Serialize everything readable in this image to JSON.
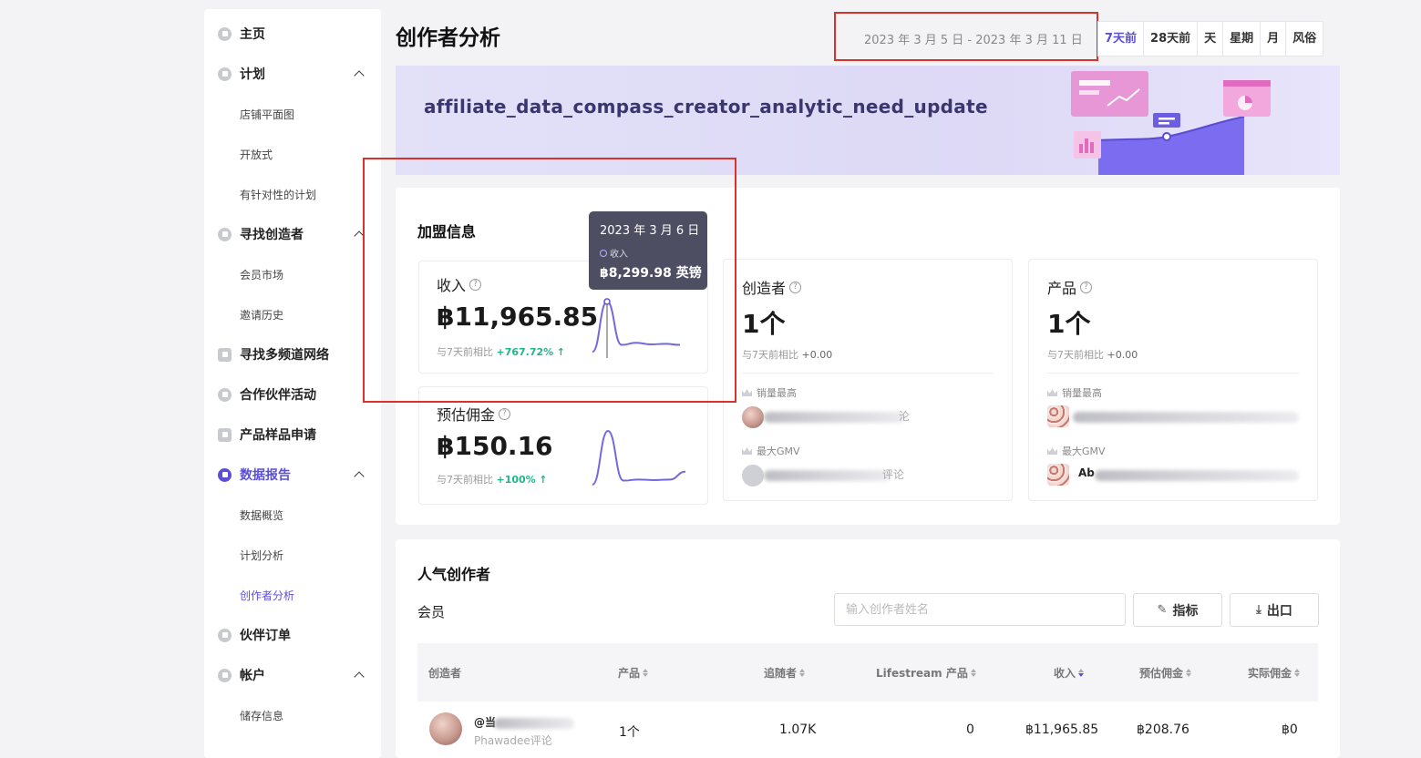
{
  "sidebar": {
    "home": "主页",
    "plan": "计划",
    "plan_items": [
      "店铺平面图",
      "开放式",
      "有针对性的计划"
    ],
    "find_creators": "寻找创造者",
    "find_creators_items": [
      "会员市场",
      "邀请历史"
    ],
    "find_mcn": "寻找多频道网络",
    "partner_campaigns": "合作伙伴活动",
    "sample_requests": "产品样品申请",
    "data_reports": "数据报告",
    "data_reports_items": [
      "数据概览",
      "计划分析",
      "创作者分析"
    ],
    "partner_orders": "伙伴订单",
    "account": "帐户",
    "account_items": [
      "储存信息"
    ]
  },
  "header": {
    "title": "创作者分析",
    "date_range": "2023 年 3 月 5 日 - 2023 年 3 月 11 日",
    "periods": [
      "7天前",
      "28天前",
      "天",
      "星期",
      "月",
      "风俗"
    ],
    "active_period": "7天前"
  },
  "banner": {
    "text": "affiliate_data_compass_creator_analytic_need_update"
  },
  "affiliate_info": {
    "title": "加盟信息",
    "revenue": {
      "label": "收入",
      "value": "฿11,965.85",
      "compare_label": "与7天前相比",
      "compare_value": "+767.72%",
      "sparkline": [
        0.05,
        1.0,
        0.18,
        0.22,
        0.19,
        0.2,
        0.18
      ]
    },
    "est_commission": {
      "label": "预估佣金",
      "value": "฿150.16",
      "compare_label": "与7天前相比",
      "compare_value": "+100%",
      "sparkline": [
        0.05,
        1.0,
        0.12,
        0.14,
        0.13,
        0.14,
        0.28
      ]
    },
    "creators": {
      "label": "创造者",
      "value": "1个",
      "compare_label": "与7天前相比",
      "compare_value": "+0.00",
      "top_sales_label": "销量最高",
      "top_gmv_label": "最大GMV",
      "top_sales_tail": "沦",
      "top_gmv_tail": "评论"
    },
    "products": {
      "label": "产品",
      "value": "1个",
      "compare_label": "与7天前相比",
      "compare_value": "+0.00",
      "top_sales_label": "销量最高",
      "top_gmv_label": "最大GMV",
      "top_gmv_prefix": "Ab"
    },
    "tooltip": {
      "date": "2023 年 3 月 6 日",
      "series": "收入",
      "value": "฿8,299.98 英镑"
    }
  },
  "popular_creators": {
    "title": "人气创作者",
    "member_label": "会员",
    "search_placeholder": "输入创作者姓名",
    "metrics_button": "指标",
    "export_button": "出口",
    "columns": [
      "创造者",
      "产品",
      "追随者",
      "Lifestream 产品",
      "收入",
      "预估佣金",
      "实际佣金"
    ],
    "rows": [
      {
        "handle": "@当",
        "subtitle": "Phawadee评论",
        "products": "1个",
        "followers": "1.07K",
        "live_products": "0",
        "revenue": "฿11,965.85",
        "est_commission": "฿208.76",
        "actual_commission": "฿0"
      }
    ]
  },
  "colors": {
    "accent": "#5b4fd6",
    "up": "#1db58a",
    "highlight_box": "#d9312b"
  }
}
